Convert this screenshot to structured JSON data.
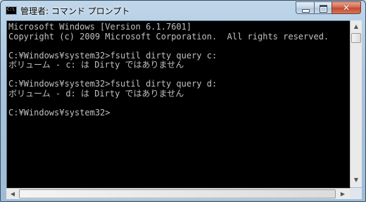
{
  "window": {
    "title": "管理者: コマンド プロンプト",
    "app_icon_text": "C:\\"
  },
  "console": {
    "lines": [
      "Microsoft Windows [Version 6.1.7601]",
      "Copyright (c) 2009 Microsoft Corporation.  All rights reserved.",
      "",
      "C:¥Windows¥system32>fsutil dirty query c:",
      "ボリューム - c: は Dirty ではありません",
      "",
      "C:¥Windows¥system32>fsutil dirty query d:",
      "ボリューム - d: は Dirty ではありません",
      "",
      "C:¥Windows¥system32>"
    ]
  },
  "controls": {
    "minimize_icon": "minimize-icon",
    "maximize_icon": "maximize-icon",
    "close_icon": "close-icon",
    "close_glyph": "✕"
  },
  "scrollbars": {
    "up_arrow": "▲",
    "down_arrow": "▼",
    "left_arrow": "◀",
    "right_arrow": "▶"
  },
  "colors": {
    "console_bg": "#000000",
    "console_fg": "#c0c0c0"
  }
}
